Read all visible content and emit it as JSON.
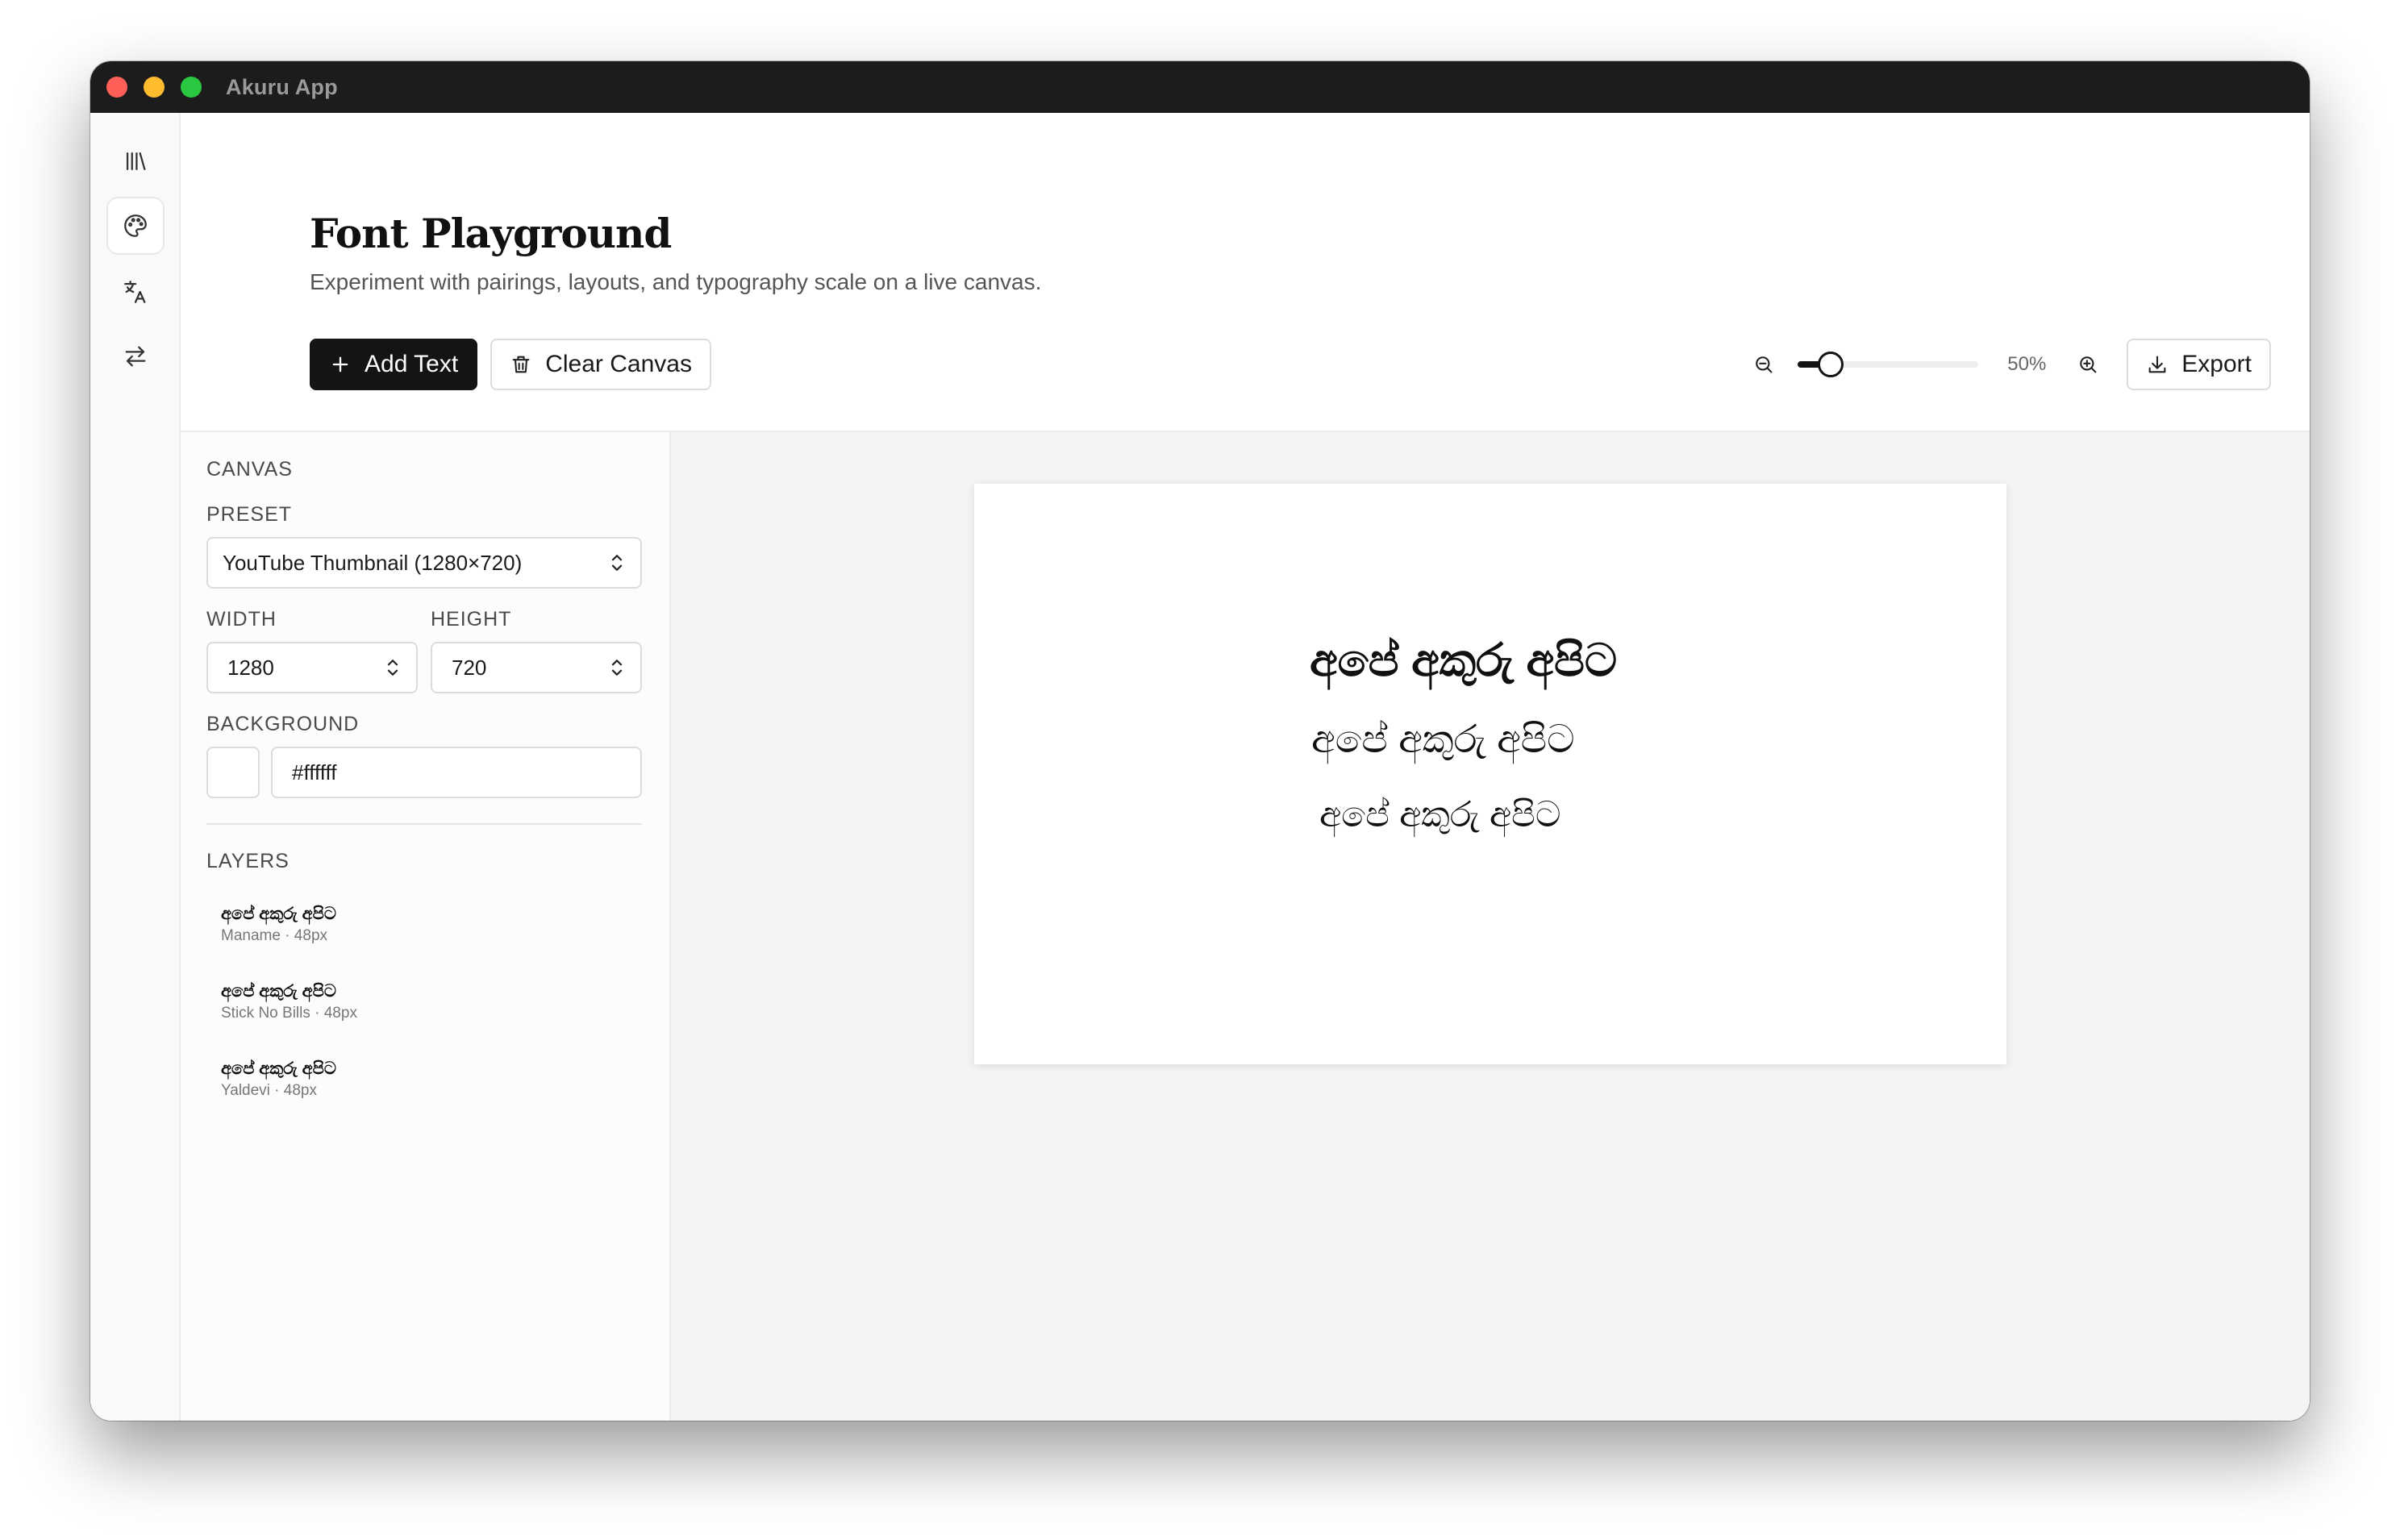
{
  "window": {
    "title": "Akuru App"
  },
  "rail": {
    "items": [
      {
        "icon": "library-icon"
      },
      {
        "icon": "palette-icon"
      },
      {
        "icon": "translate-icon"
      },
      {
        "icon": "convert-icon"
      }
    ]
  },
  "header": {
    "title": "Font Playground",
    "subtitle": "Experiment with pairings, layouts, and typography scale on a live canvas.",
    "add_text_label": "Add Text",
    "clear_canvas_label": "Clear Canvas",
    "zoom_label": "50%",
    "zoom_fraction": 0.18,
    "export_label": "Export"
  },
  "panel": {
    "canvas_section": "CANVAS",
    "preset_label": "PRESET",
    "preset_value": "YouTube Thumbnail (1280×720)",
    "width_label": "WIDTH",
    "width_value": "1280",
    "height_label": "HEIGHT",
    "height_value": "720",
    "background_label": "BACKGROUND",
    "background_value": "#ffffff",
    "layers_section": "LAYERS",
    "layers": [
      {
        "text": "අපේ අකුරු අපිට",
        "meta": "Maname · 48px"
      },
      {
        "text": "අපේ අකුරු අපිට",
        "meta": "Stick No Bills · 48px"
      },
      {
        "text": "අපේ අකුරු අපිට",
        "meta": "Yaldevi · 48px"
      }
    ]
  },
  "canvas": {
    "background": "#ffffff",
    "texts": [
      "අපේ අකුරු අපිට",
      "අපේ අකුරු අපිට",
      "අපේ අකුරු අපිට"
    ]
  }
}
